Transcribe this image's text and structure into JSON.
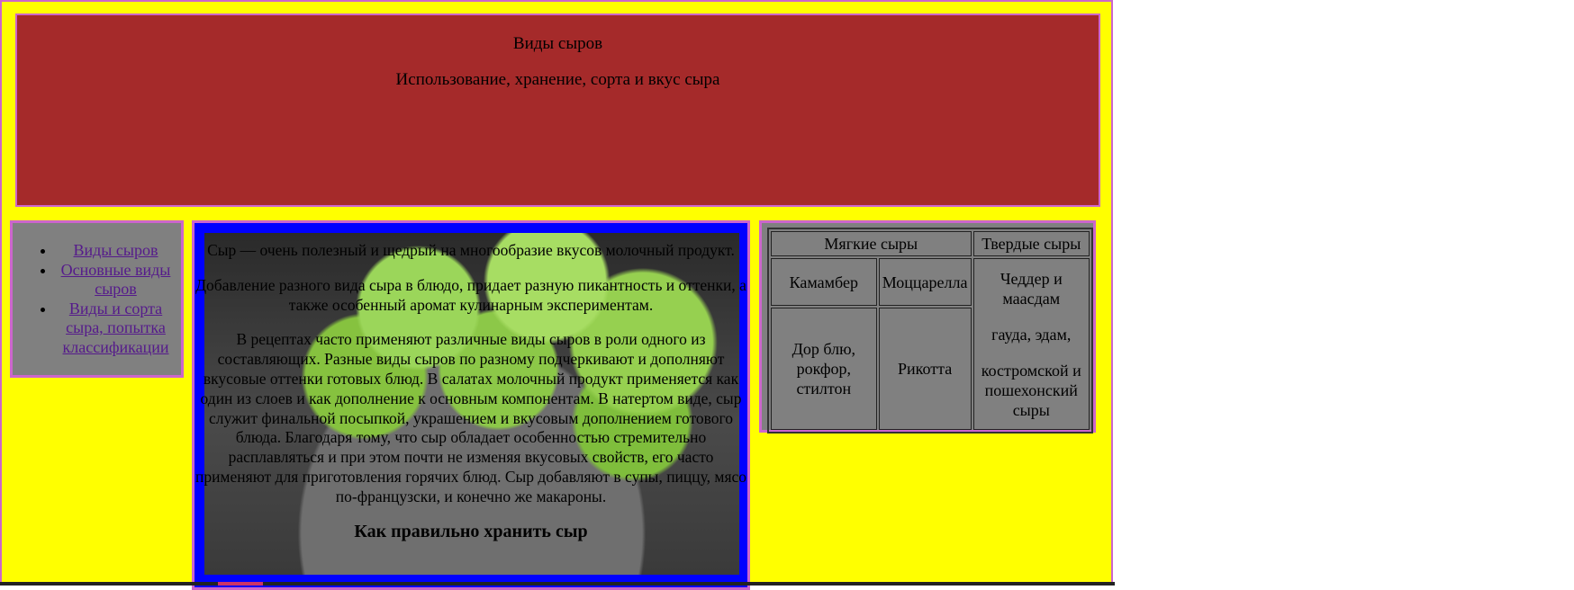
{
  "header": {
    "title": "Виды сыров",
    "subtitle": "Использование, хранение, сорта и вкус сыра"
  },
  "sidebar": {
    "items": [
      {
        "label": "Виды сыров"
      },
      {
        "label": "Основные виды сыров"
      },
      {
        "label": "Виды и сорта сыра, попытка классификации"
      }
    ]
  },
  "main": {
    "paragraphs": [
      "Сыр — очень полезный и щедрый на многообразие вкусов молочный продукт.",
      "Добавление разного вида сыра в блюдо, придает разную пикантность и оттенки, а также особенный аромат кулинарным экспериментам.",
      "В рецептах часто применяют различные виды сыров в роли одного из составляющих. Разные виды сыров по разному подчеркивают и дополняют вкусовые оттенки готовых блюд. В салатах молочный продукт применяется как один из слоев и как дополнение к основным компонентам. В натертом виде, сыр служит финальной посыпкой, украшением и вкусовым дополнением готового блюда. Благодаря тому, что сыр обладает особенностью стремительно расплавляться и при этом почти не изменяя вкусовых свойств, его часто применяют для приготовления горячих блюд. Сыр добавляют в супы, пиццу, мясо по-французски, и конечно же макароны."
    ],
    "heading": "Как правильно хранить сыр"
  },
  "table": {
    "headers": [
      "Мягкие сыры",
      "Твердые сыры"
    ],
    "soft_row1": [
      "Камамбер",
      "Моццарелла"
    ],
    "soft_row2": [
      "Дор блю, рокфор, стилтон",
      "Рикотта"
    ],
    "hard": [
      "Чеддер и маасдам",
      "гауда, эдам,",
      "костромской и пошехонский сыры"
    ]
  },
  "colors": {
    "page_bg": "#ffff00",
    "header_bg": "#a52a2a",
    "panel_bg": "#808080",
    "main_border": "#0000ff",
    "outline": "#cc66cc",
    "link": "#551a8b"
  }
}
